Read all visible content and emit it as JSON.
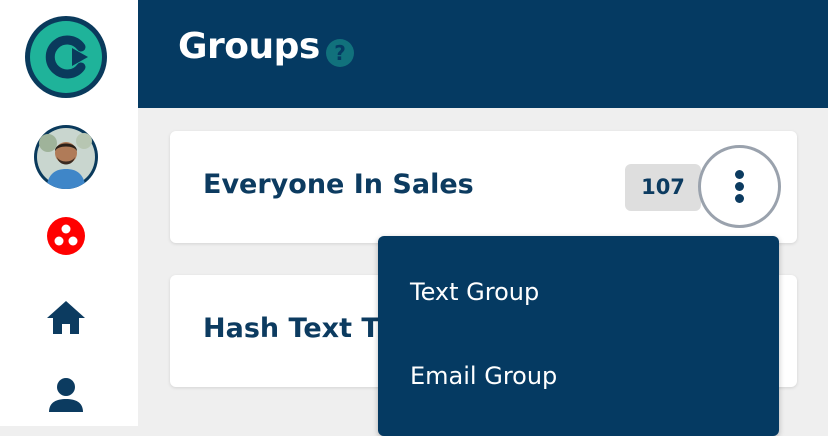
{
  "header": {
    "title": "Groups",
    "help_glyph": "?"
  },
  "sidebar": {
    "icons": [
      "logo-icon",
      "avatar",
      "groups-icon",
      "home-icon",
      "person-icon"
    ],
    "colors": {
      "logo_teal": "#1fb39a",
      "logo_navy": "#0a3a5c",
      "groups_red": "#ff0000",
      "nav_navy": "#0c3b60"
    }
  },
  "groups": [
    {
      "name": "Everyone In Sales",
      "count": "107"
    },
    {
      "name": "Hash Text T"
    }
  ],
  "menu": {
    "items": [
      "Text Group",
      "Email Group"
    ]
  },
  "colors": {
    "header_bg": "#053a62",
    "page_bg": "#efefef",
    "accent_teal": "#11717c",
    "text_navy": "#0c3b60"
  }
}
